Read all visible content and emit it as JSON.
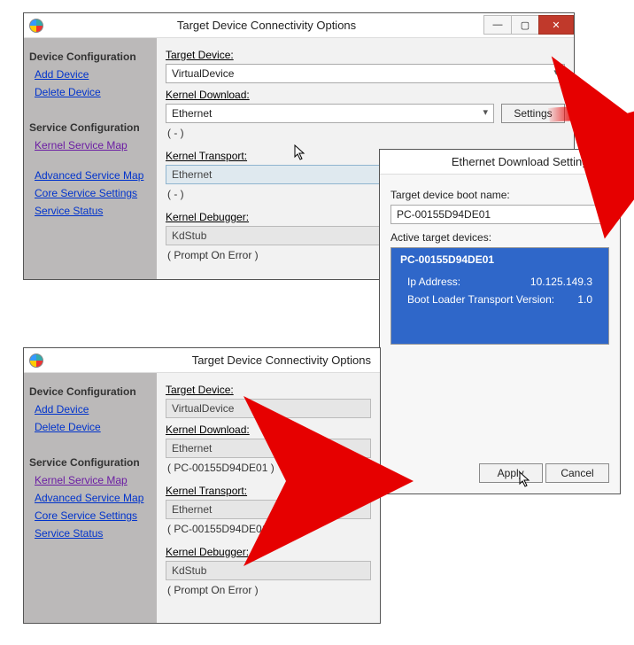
{
  "win1": {
    "title": "Target Device Connectivity Options",
    "sidebar": {
      "heading1": "Device Configuration",
      "add": "Add Device",
      "del": "Delete Device",
      "heading2": "Service Configuration",
      "ksm": "Kernel Service Map",
      "asm": "Advanced Service Map",
      "css": "Core Service Settings",
      "ss": "Service Status"
    },
    "targetDeviceLabel": "Target Device:",
    "targetDeviceValue": "VirtualDevice",
    "kernelDownloadLabel": "Kernel Download:",
    "kernelDownloadValue": "Ethernet",
    "kernelDownloadSub": "( - )",
    "settingsBtn": "Settings",
    "kernelTransportLabel": "Kernel Transport:",
    "kernelTransportValue": "Ethernet",
    "kernelTransportSub": "( - )",
    "kernelDebuggerLabel": "Kernel Debugger:",
    "kernelDebuggerValue": "KdStub",
    "kernelDebuggerSub": "( Prompt On Error )"
  },
  "eth": {
    "title": "Ethernet Download Settings",
    "bootNameLabel": "Target device boot name:",
    "bootNameValue": "PC-00155D94DE01",
    "activeLabel": "Active target devices:",
    "deviceName": "PC-00155D94DE01",
    "ipLabel": "Ip Address:",
    "ipValue": "10.125.149.3",
    "btvLabel": "Boot Loader Transport Version:",
    "btvValue": "1.0",
    "apply": "Apply",
    "cancel": "Cancel"
  },
  "win2": {
    "title": "Target Device Connectivity Options",
    "targetDeviceLabel": "Target Device:",
    "targetDeviceValue": "VirtualDevice",
    "kernelDownloadLabel": "Kernel Download:",
    "kernelDownloadValue": "Ethernet",
    "kernelDownloadSub": "( PC-00155D94DE01 )",
    "kernelTransportLabel": "Kernel Transport:",
    "kernelTransportValue": "Ethernet",
    "kernelTransportSub": "( PC-00155D94DE01 )",
    "kernelDebuggerLabel": "Kernel Debugger:",
    "kernelDebuggerValue": "KdStub",
    "kernelDebuggerSub": "( Prompt On Error )"
  }
}
